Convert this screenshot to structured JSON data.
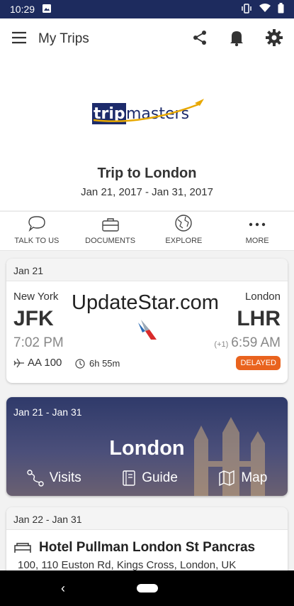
{
  "status_bar": {
    "time": "10:29"
  },
  "app_bar": {
    "title": "My Trips"
  },
  "logo": {
    "text_trip": "trip",
    "text_masters": "masters"
  },
  "trip": {
    "title": "Trip to London",
    "dates": "Jan 21, 2017 - Jan 31, 2017"
  },
  "tabs": [
    {
      "label": "TALK TO US",
      "icon": "chat-bubble-icon"
    },
    {
      "label": "DOCUMENTS",
      "icon": "briefcase-icon"
    },
    {
      "label": "EXPLORE",
      "icon": "globe-icon"
    },
    {
      "label": "MORE",
      "icon": "more-dots-icon"
    }
  ],
  "flight": {
    "date": "Jan 21",
    "from_city": "New York",
    "from_code": "JFK",
    "to_city": "London",
    "to_code": "LHR",
    "watermark": "UpdateStar.com",
    "dep_time": "7:02 PM",
    "arr_offset": "(+1)",
    "arr_time": "6:59 AM",
    "flight_no": "AA 100",
    "duration": "6h 55m",
    "status": "DELAYED"
  },
  "city_card": {
    "dates": "Jan 21 - Jan 31",
    "city": "London",
    "links": [
      "Visits",
      "Guide",
      "Map"
    ]
  },
  "hotel": {
    "dates": "Jan 22 - Jan 31",
    "name": "Hotel Pullman London St Pancras",
    "address": "100, 110 Euston Rd, Kings Cross, London, UK"
  },
  "colors": {
    "status_bar": "#1d2b5e",
    "delayed": "#e9631e",
    "logo_navy": "#1d2b6b",
    "logo_gold": "#e8a800"
  }
}
